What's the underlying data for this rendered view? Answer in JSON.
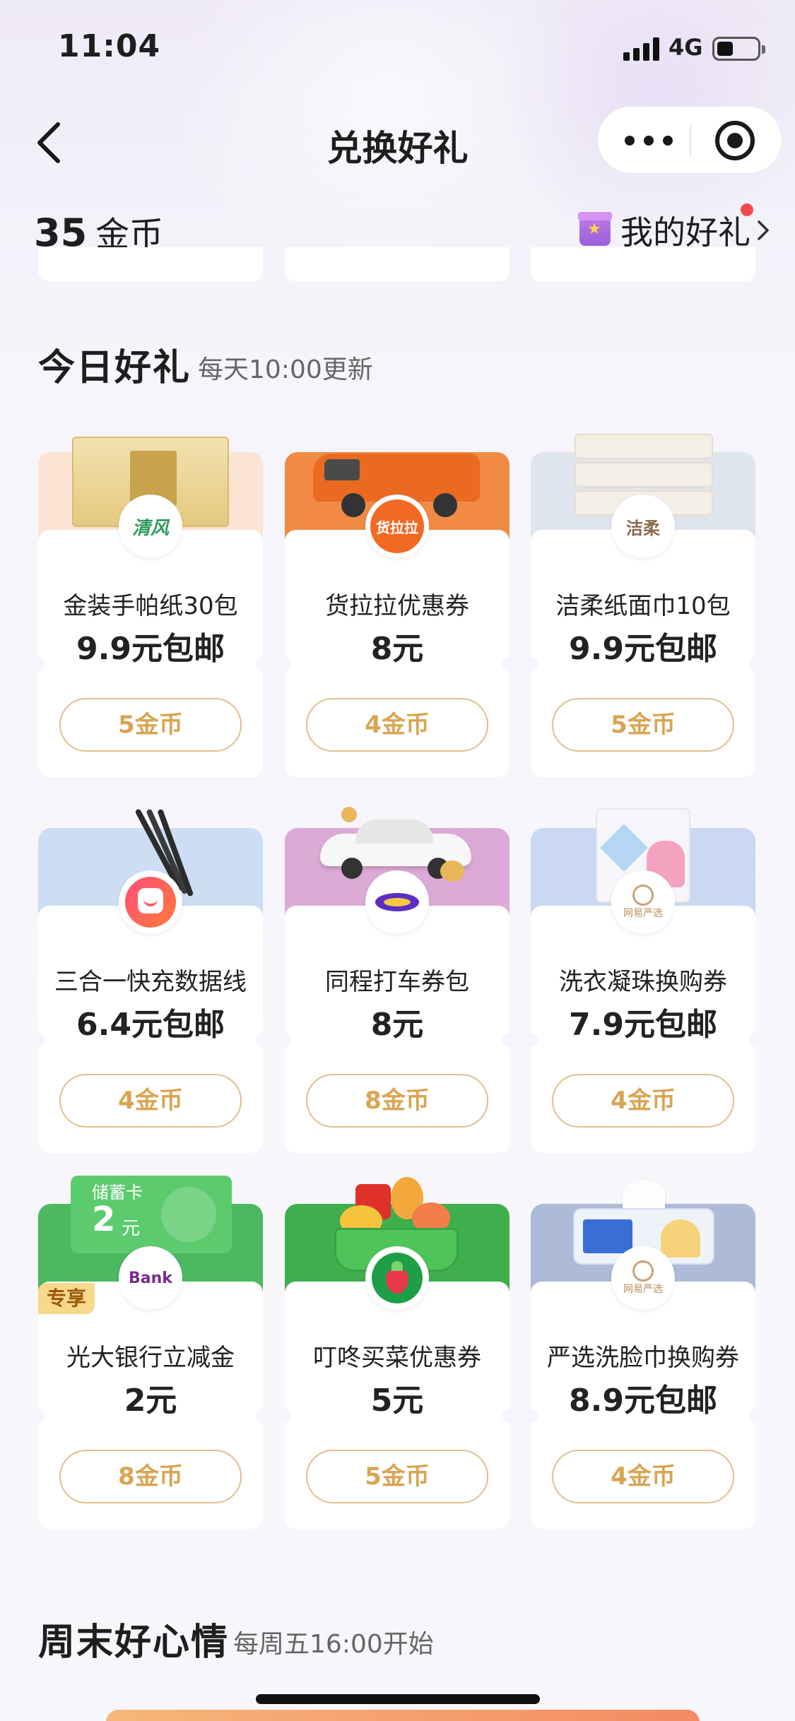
{
  "status_bar": {
    "time": "11:04",
    "network": "4G"
  },
  "nav": {
    "title": "兑换好礼"
  },
  "header": {
    "coins_value": "35",
    "coins_unit": "金币",
    "my_gifts_label": "我的好礼"
  },
  "today": {
    "title": "今日好礼",
    "subtitle": "每天10:00更新",
    "cards": [
      {
        "name": "金装手帕纸30包",
        "price": "9.9元包邮",
        "cost": "5金币",
        "banner_color": "#fbe4d4",
        "logo_text": "清风"
      },
      {
        "name": "货拉拉优惠券",
        "price": "8元",
        "cost": "4金币",
        "banner_color": "#f08a45",
        "logo_text": "货拉拉"
      },
      {
        "name": "洁柔纸面巾10包",
        "price": "9.9元包邮",
        "cost": "5金币",
        "banner_color": "#dfe5ef",
        "logo_text": "洁柔"
      },
      {
        "name": "三合一快充数据线",
        "price": "6.4元包邮",
        "cost": "4金币",
        "banner_color": "#cdddf3",
        "logo_text": ""
      },
      {
        "name": "同程打车券包",
        "price": "8元",
        "cost": "8金币",
        "banner_color": "#dcaad6",
        "logo_text": ""
      },
      {
        "name": "洗衣凝珠换购券",
        "price": "7.9元包邮",
        "cost": "4金币",
        "banner_color": "#cad8f2",
        "logo_text": "网易严选"
      },
      {
        "name": "光大银行立减金",
        "price": "2元",
        "cost": "8金币",
        "banner_color": "#4cb860",
        "logo_text": "Bank",
        "tag": "专享",
        "coupon_label": "储蓄卡",
        "coupon_value": "2",
        "coupon_unit": "元"
      },
      {
        "name": "叮咚买菜优惠券",
        "price": "5元",
        "cost": "5金币",
        "banner_color": "#3fae4d",
        "logo_text": ""
      },
      {
        "name": "严选洗脸巾换购券",
        "price": "8.9元包邮",
        "cost": "4金币",
        "banner_color": "#aebbd8",
        "logo_text": "网易严选"
      }
    ]
  },
  "weekend": {
    "title": "周末好心情",
    "subtitle": "每周五16:00开始"
  },
  "colors": {
    "accent_gold": "#d9a552",
    "button_border": "#e0bf8a",
    "badge_red": "#f24a4a"
  }
}
